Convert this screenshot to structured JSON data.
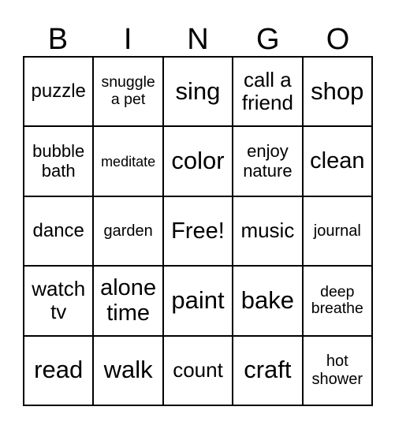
{
  "header": {
    "letters": [
      "B",
      "I",
      "N",
      "G",
      "O"
    ]
  },
  "card": {
    "rows": [
      [
        "puzzle",
        "snuggle a pet",
        "sing",
        "call a friend",
        "shop"
      ],
      [
        "bubble bath",
        "meditate",
        "color",
        "enjoy nature",
        "clean"
      ],
      [
        "dance",
        "garden",
        "Free!",
        "music",
        "journal"
      ],
      [
        "watch tv",
        "alone time",
        "paint",
        "bake",
        "deep breathe"
      ],
      [
        "read",
        "walk",
        "count",
        "craft",
        "hot shower"
      ]
    ]
  }
}
